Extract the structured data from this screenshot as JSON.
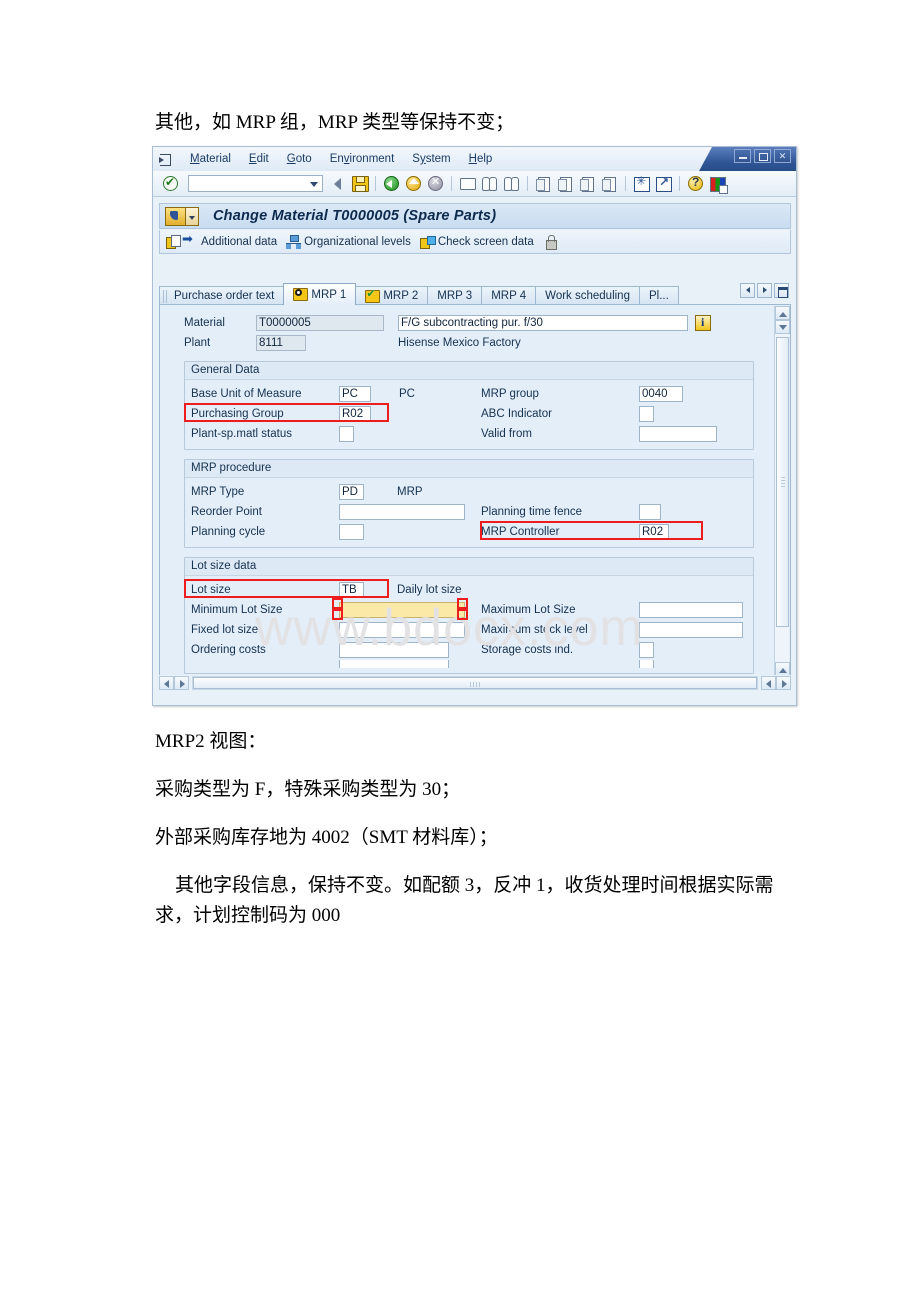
{
  "document": {
    "para_top": "其他，如 MRP 组，MRP 类型等保持不变；",
    "para_mrp2_view": "MRP2 视图：",
    "para_purchase": "采购类型为 F，特殊采购类型为 30；",
    "para_stock": "外部采购库存地为 4002（SMT 材料库）；",
    "para_other": "其他字段信息，保持不变。如配额 3，反冲 1，收货处理时间根据实际需求，计划控制码为 000"
  },
  "watermark": "www.bdocx.com",
  "window": {
    "controls": {
      "minimize": "_",
      "maximize": "□",
      "close": "✕"
    },
    "menu": [
      "Material",
      "Edit",
      "Goto",
      "Environment",
      "System",
      "Help"
    ],
    "menu_mnemonics": [
      "M",
      "E",
      "G",
      "v",
      "y",
      "H"
    ],
    "command_field_value": "",
    "toolbar_icons": [
      "enter-check-icon",
      "back-arrow-icon",
      "save-icon",
      "exit-icon",
      "cancel-home-icon",
      "cancel-icon",
      "print-icon",
      "find-icon",
      "find-next-icon",
      "first-page-icon",
      "previous-page-icon",
      "next-page-icon",
      "last-page-icon",
      "new-session-icon",
      "create-shortcut-icon",
      "help-icon",
      "customize-layout-icon"
    ],
    "program_title": "Change Material T0000005 (Spare Parts)",
    "app_toolbar": [
      {
        "label": "Additional data",
        "icon": "additional-data-icon"
      },
      {
        "label": "Organizational levels",
        "icon": "org-levels-icon"
      },
      {
        "label": "Check screen data",
        "icon": "check-screen-data-icon"
      },
      {
        "label": "",
        "icon": "lock-icon"
      }
    ],
    "tabs": [
      {
        "label": "Purchase order text",
        "icon": "",
        "active": false
      },
      {
        "label": "MRP 1",
        "icon": "tab-status-current-icon",
        "active": true
      },
      {
        "label": "MRP 2",
        "icon": "tab-status-complete-icon",
        "active": false
      },
      {
        "label": "MRP 3",
        "icon": "",
        "active": false
      },
      {
        "label": "MRP 4",
        "icon": "",
        "active": false
      },
      {
        "label": "Work scheduling",
        "icon": "",
        "active": false
      },
      {
        "label": "Pl...",
        "icon": "",
        "active": false
      }
    ],
    "header": {
      "material_label": "Material",
      "material_value": "T0000005",
      "material_desc": "F/G subcontracting pur. f/30",
      "plant_label": "Plant",
      "plant_value": "8111",
      "plant_desc": "Hisense Mexico Factory"
    },
    "general_data": {
      "title": "General Data",
      "rows": [
        {
          "left_label": "Base Unit of Measure",
          "left_value": "PC",
          "left_suffix": "PC",
          "right_label": "MRP group",
          "right_value": "0040",
          "highlight": false
        },
        {
          "left_label": "Purchasing Group",
          "left_value": "R02",
          "left_suffix": "",
          "right_label": "ABC Indicator",
          "right_value": "",
          "highlight": true
        },
        {
          "left_label": "Plant-sp.matl status",
          "left_value": "",
          "left_suffix": "",
          "right_label": "Valid from",
          "right_value": "",
          "highlight": false
        }
      ]
    },
    "mrp_procedure": {
      "title": "MRP procedure",
      "rows": [
        {
          "left_label": "MRP Type",
          "left_value": "PD",
          "left_suffix": "MRP",
          "right_label": "",
          "right_value": "",
          "highlight": false
        },
        {
          "left_label": "Reorder Point",
          "left_value": "",
          "left_suffix": "",
          "right_label": "Planning time fence",
          "right_value": "",
          "highlight": false
        },
        {
          "left_label": "Planning cycle",
          "left_value": "",
          "left_suffix": "",
          "right_label": "MRP Controller",
          "right_value": "R02",
          "highlight": true
        }
      ]
    },
    "lot_size_data": {
      "title": "Lot size data",
      "rows": [
        {
          "left_label": "Lot size",
          "left_value": "TB",
          "left_suffix": "Daily lot size",
          "right_label": "",
          "right_value": "",
          "highlight": true
        },
        {
          "left_label": "Minimum Lot Size",
          "left_value": "",
          "left_suffix": "",
          "right_label": "Maximum Lot Size",
          "right_value": "",
          "highlight": false
        },
        {
          "left_label": "Fixed lot size",
          "left_value": "",
          "left_suffix": "",
          "right_label": "Maximum stock level",
          "right_value": "",
          "highlight": false
        },
        {
          "left_label": "Ordering costs",
          "left_value": "",
          "left_suffix": "",
          "right_label": "Storage costs ind.",
          "right_value": "",
          "highlight": false
        }
      ]
    }
  },
  "colors": {
    "annotation_red": "#ee1c1c",
    "focus_yellow": "#fbe9a8",
    "sap_blue": "#e3eef9",
    "title_blue": "#0d2a4d"
  }
}
